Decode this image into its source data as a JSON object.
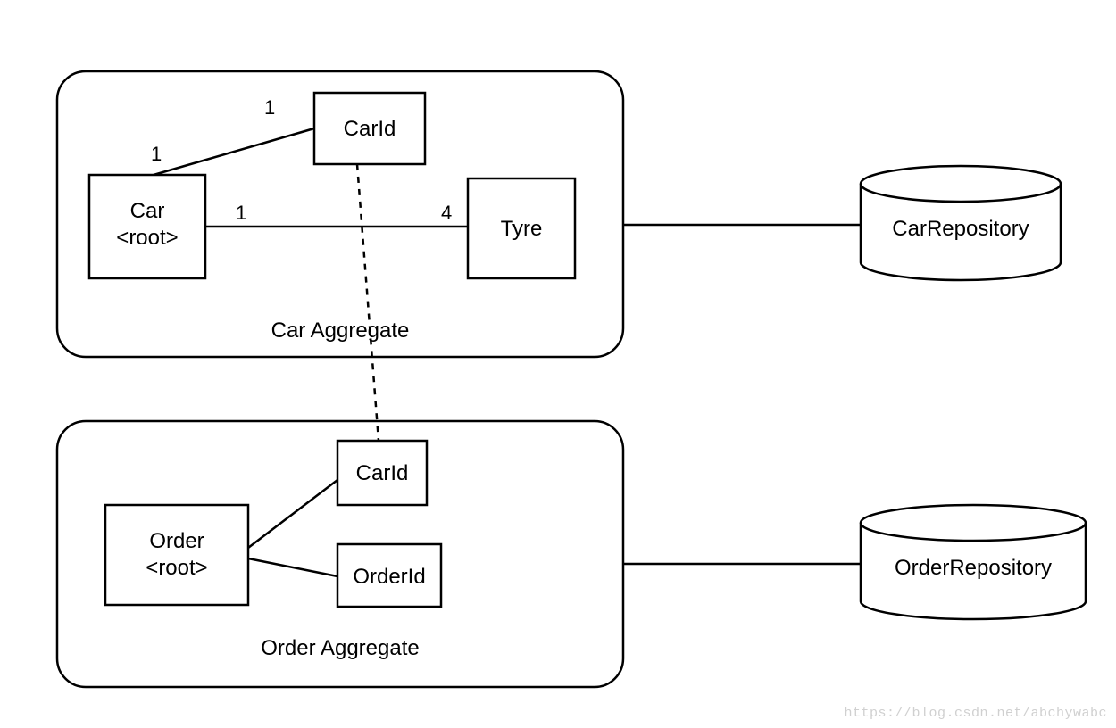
{
  "carAggregate": {
    "label": "Car Aggregate",
    "root": {
      "name": "Car",
      "stereotype": "<root>"
    },
    "entities": {
      "carId": "CarId",
      "tyre": "Tyre"
    },
    "multiplicities": {
      "car_to_carId_left": "1",
      "car_to_carId_right": "1",
      "car_to_tyre_left": "1",
      "car_to_tyre_right": "4"
    },
    "repository": "CarRepository"
  },
  "orderAggregate": {
    "label": "Order Aggregate",
    "root": {
      "name": "Order",
      "stereotype": "<root>"
    },
    "entities": {
      "carId": "CarId",
      "orderId": "OrderId"
    },
    "repository": "OrderRepository"
  },
  "watermark": "https://blog.csdn.net/abchywabc"
}
